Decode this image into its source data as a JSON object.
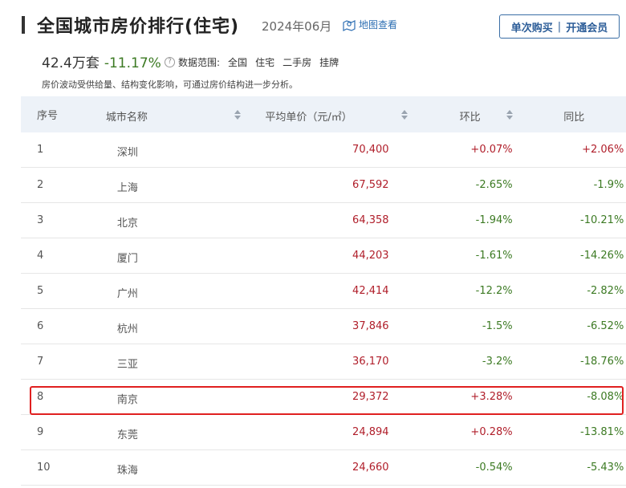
{
  "header": {
    "title": "全国城市房价排行(住宅)",
    "date": "2024年06月",
    "map_link": "地图查看",
    "buy_once": "单次购买",
    "separator": "|",
    "open_vip": "开通会员"
  },
  "summary": {
    "price": "42.4万套",
    "change": "-11.17%",
    "scope_label": "数据范围:",
    "scope_tags": [
      "全国",
      "住宅",
      "二手房",
      "挂牌"
    ],
    "note": "房价波动受供给量、结构变化影响，可通过房价结构进一步分析。"
  },
  "table": {
    "columns": {
      "rank": "序号",
      "city": "城市名称",
      "price": "平均单价（元/㎡）",
      "mom": "环比",
      "yoy": "同比"
    },
    "rows": [
      {
        "rank": "1",
        "city": "深圳",
        "price": "70,400",
        "mom": "+0.07%",
        "yoy": "+2.06%"
      },
      {
        "rank": "2",
        "city": "上海",
        "price": "67,592",
        "mom": "-2.65%",
        "yoy": "-1.9%"
      },
      {
        "rank": "3",
        "city": "北京",
        "price": "64,358",
        "mom": "-1.94%",
        "yoy": "-10.21%"
      },
      {
        "rank": "4",
        "city": "厦门",
        "price": "44,203",
        "mom": "-1.61%",
        "yoy": "-14.26%"
      },
      {
        "rank": "5",
        "city": "广州",
        "price": "42,414",
        "mom": "-12.2%",
        "yoy": "-2.82%"
      },
      {
        "rank": "6",
        "city": "杭州",
        "price": "37,846",
        "mom": "-1.5%",
        "yoy": "-6.52%"
      },
      {
        "rank": "7",
        "city": "三亚",
        "price": "36,170",
        "mom": "-3.2%",
        "yoy": "-18.76%"
      },
      {
        "rank": "8",
        "city": "南京",
        "price": "29,372",
        "mom": "+3.28%",
        "yoy": "-8.08%"
      },
      {
        "rank": "9",
        "city": "东莞",
        "price": "24,894",
        "mom": "+0.28%",
        "yoy": "-13.81%"
      },
      {
        "rank": "10",
        "city": "珠海",
        "price": "24,660",
        "mom": "-0.54%",
        "yoy": "-5.43%"
      }
    ]
  },
  "colors": {
    "rise": "#b01e2a",
    "fall": "#3c7a23",
    "header_bg": "#edf2f8",
    "link": "#2e6fb3",
    "highlight_box": "#e02020"
  },
  "icons": {
    "map": "map-pin-icon",
    "help": "question-circle-icon",
    "sort": "sort-arrows-icon"
  }
}
